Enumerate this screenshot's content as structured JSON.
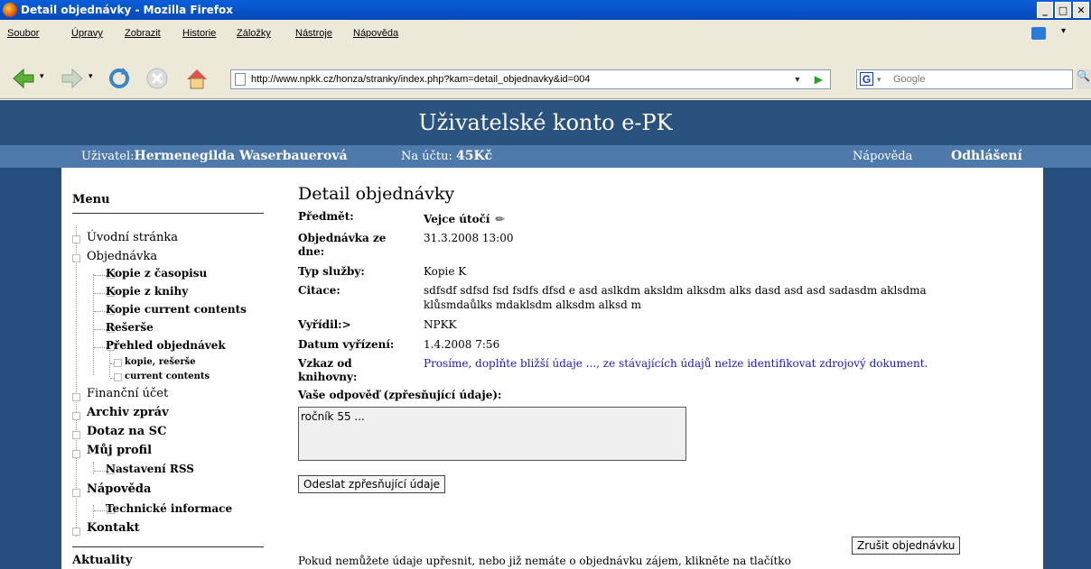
{
  "window": {
    "title": "Detail objednávky - Mozilla Firefox"
  },
  "menu": [
    "Soubor",
    "Úpravy",
    "Zobrazit",
    "Historie",
    "Záložky",
    "Nástroje",
    "Nápověda"
  ],
  "toolbar": {
    "url": "http://www.npkk.cz/honza/stranky/index.php?kam=detail_objednavky&id=004",
    "search_placeholder": "Google"
  },
  "site": {
    "title": "Uživatelské konto e-PK",
    "user_label": "Uživatel:",
    "user_name": "Hermenegilda Waserbauerová",
    "account_label": "Na účtu:",
    "account_value": "45Kč",
    "help": "Nápověda",
    "logout": "Odhlášení"
  },
  "sidebar": {
    "menu_title": "Menu",
    "items": [
      "Úvodní stránka",
      "Objednávka",
      "Kopie z časopisu",
      "Kopie z knihy",
      "Kopie current contents",
      "Rešerše",
      "Přehled objednávek",
      "kopie, rešerše",
      "current contents",
      "Finanční účet",
      "Archiv zpráv",
      "Dotaz na SC",
      "Můj profil",
      "Nastavení RSS",
      "Nápověda",
      "Technické informace",
      "Kontakt"
    ],
    "news_title": "Aktuality"
  },
  "detail": {
    "heading": "Detail objednávky",
    "fields": [
      {
        "label": "Předmět:",
        "value": "Vejce útočí"
      },
      {
        "label": "Objednávka ze dne:",
        "value": "31.3.2008 13:00"
      },
      {
        "label": "Typ služby:",
        "value": "Kopie K"
      },
      {
        "label": "Citace:",
        "value": "sdfsdf sdfsd fsd fsdfs dfsd e asd aslkdm aksldm alksdm alks dasd asd asd sadasdm aklsdma",
        "value2": "klůsmdaůlks mdaklsdm alksdm alksd m"
      },
      {
        "label": "Vyřídil:>",
        "value": "NPKK"
      },
      {
        "label": "Datum vyřízení:",
        "value": "1.4.2008 7:56"
      },
      {
        "label": "Vzkaz od knihovny:",
        "value": "Prosíme, doplňte bližší údaje ..., ze stávajících údajů nelze identifikovat zdrojový dokument."
      }
    ],
    "reply_label": "Vaše odpověď (zpřesňující údaje):",
    "reply_value": "ročník 55 ...",
    "send_button": "Odeslat zpřesňující údaje",
    "cancel_button": "Zrušit objednávku",
    "footer_text": "Pokud nemůžete údaje upřesnit, nebo již nemáte o objednávku zájem, klikněte na tlačítko"
  }
}
